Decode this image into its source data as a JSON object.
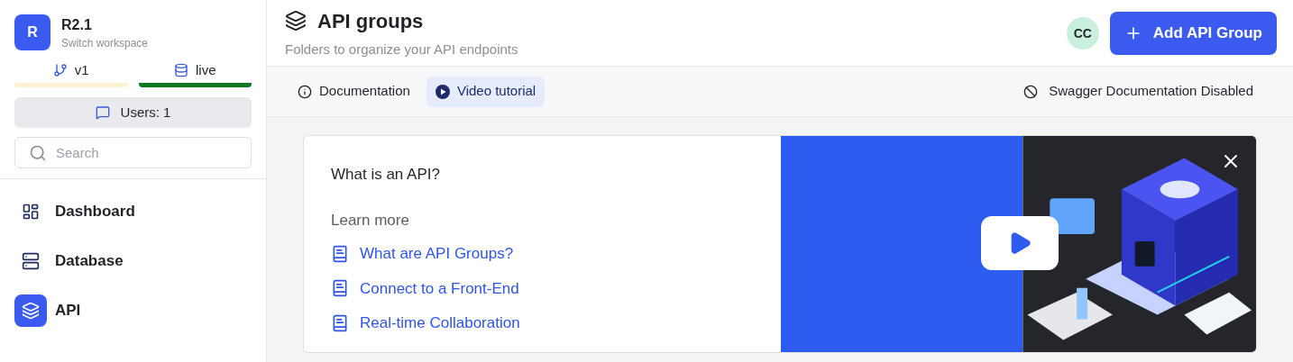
{
  "workspace": {
    "initial": "R",
    "name": "R2.1",
    "subtitle": "Switch workspace"
  },
  "environments": [
    {
      "kind": "branch",
      "label": "v1",
      "color": "#fdf3d4"
    },
    {
      "kind": "datasource",
      "label": "live",
      "color": "#0f7a23"
    }
  ],
  "users_button": {
    "label": "Users: 1"
  },
  "search": {
    "placeholder": "Search"
  },
  "nav": [
    {
      "kind": "dashboard",
      "label": "Dashboard",
      "selected": false
    },
    {
      "kind": "database",
      "label": "Database",
      "selected": false
    },
    {
      "kind": "api",
      "label": "API",
      "selected": true
    }
  ],
  "header": {
    "title": "API groups",
    "subtitle": "Folders to organize your API endpoints",
    "avatar": "CC",
    "add_button": "Add API Group"
  },
  "toolbar": {
    "tabs": [
      {
        "kind": "info",
        "label": "Documentation",
        "selected": false
      },
      {
        "kind": "video",
        "label": "Video tutorial",
        "selected": true
      }
    ],
    "swagger_status": "Swagger Documentation Disabled"
  },
  "tutorial_card": {
    "title": "What is an API?",
    "learn_more": "Learn more",
    "links": [
      "What are API Groups?",
      "Connect to a Front-End",
      "Real-time Collaboration"
    ]
  }
}
